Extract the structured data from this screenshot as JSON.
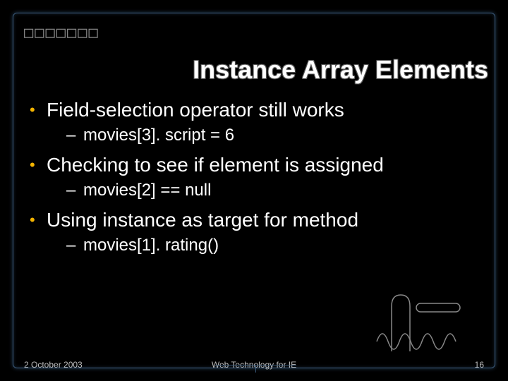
{
  "corner_glyphs": "□□□□□□□",
  "title": "Instance Array Elements",
  "bullets": [
    {
      "level": 1,
      "text": "Field-selection operator still works"
    },
    {
      "level": 2,
      "text": "movies[3]. script = 6"
    },
    {
      "level": 1,
      "text": "Checking to see if element is assigned"
    },
    {
      "level": 2,
      "text": "movies[2] == null"
    },
    {
      "level": 1,
      "text": "Using instance as target for method"
    },
    {
      "level": 2,
      "text": "movies[1]. rating()"
    }
  ],
  "footer": {
    "date": "2 October 2003",
    "center": "Web Technology for IE",
    "page": "16"
  }
}
